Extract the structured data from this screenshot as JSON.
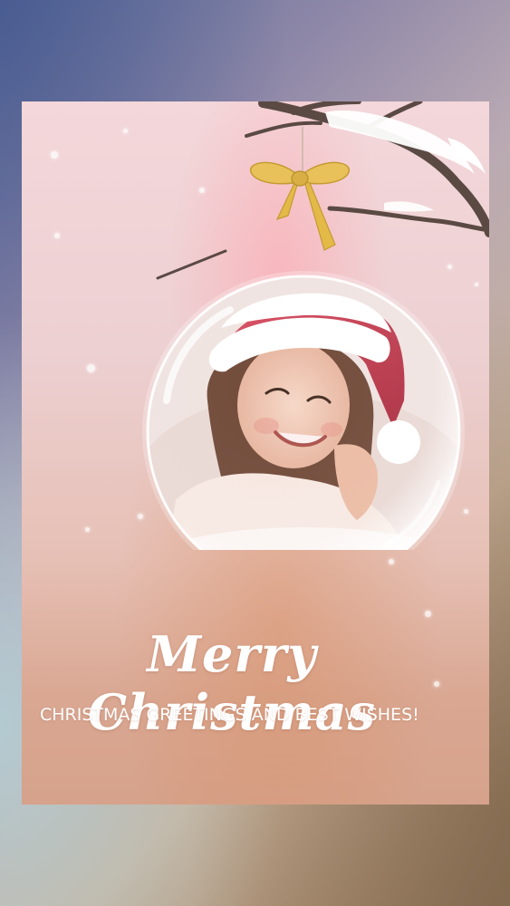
{
  "greeting": {
    "title": "Merry Christmas",
    "subtitle": "CHRISTMAS GREETINGS AND BEST WISHES!"
  },
  "ornament": {
    "photo_subject": "smiling girl in santa hat",
    "ribbon_color": "#e8c15a",
    "hat_color": "#c8374a"
  },
  "colors": {
    "card_top": "#f3d7da",
    "card_bottom": "#d6a28b",
    "text": "#ffffff"
  }
}
